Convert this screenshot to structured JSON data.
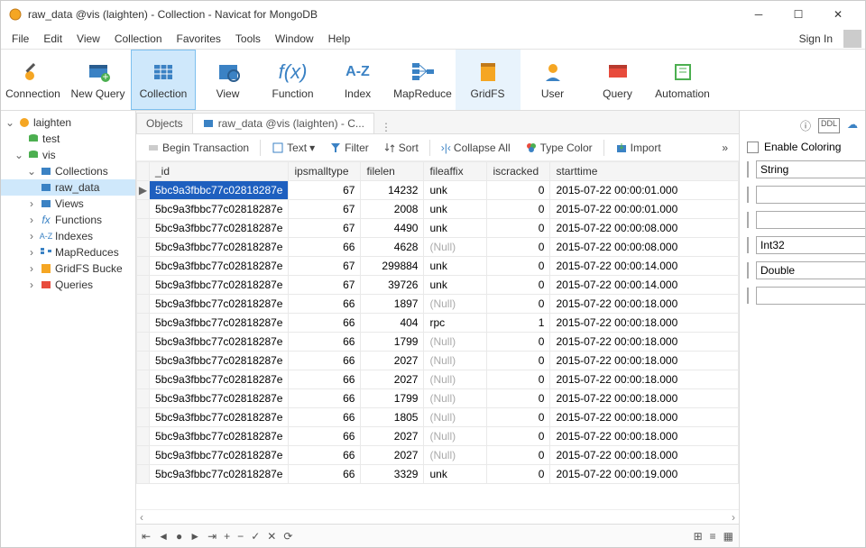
{
  "window": {
    "title": "raw_data @vis (laighten) - Collection - Navicat for MongoDB"
  },
  "menu": {
    "file": "File",
    "edit": "Edit",
    "view": "View",
    "collection": "Collection",
    "favorites": "Favorites",
    "tools": "Tools",
    "window": "Window",
    "help": "Help",
    "signin": "Sign In"
  },
  "toolbar": {
    "connection": "Connection",
    "newquery": "New Query",
    "collection": "Collection",
    "view": "View",
    "function": "Function",
    "index": "Index",
    "mapreduce": "MapReduce",
    "gridfs": "GridFS",
    "user": "User",
    "query": "Query",
    "automation": "Automation"
  },
  "tree": {
    "root": "laighten",
    "test": "test",
    "vis": "vis",
    "collections": "Collections",
    "raw_data": "raw_data",
    "views": "Views",
    "functions": "Functions",
    "indexes": "Indexes",
    "mapreduces": "MapReduces",
    "gridfs": "GridFS Bucke",
    "queries": "Queries"
  },
  "tabs": {
    "objects": "Objects",
    "active": "raw_data @vis (laighten) - C..."
  },
  "toolbar2": {
    "begin": "Begin Transaction",
    "text": "Text",
    "filter": "Filter",
    "sort": "Sort",
    "collapse": "Collapse All",
    "typecolor": "Type Color",
    "import": "Import"
  },
  "columns": {
    "id": "_id",
    "ipsmalltype": "ipsmalltype",
    "filelen": "filelen",
    "fileaffix": "fileaffix",
    "iscracked": "iscracked",
    "starttime": "starttime"
  },
  "rows": [
    {
      "id": "5bc9a3fbbc77c02818287e",
      "ip": 67,
      "len": 14232,
      "aff": "unk",
      "cr": 0,
      "st": "2015-07-22 00:00:01.000",
      "sel": true
    },
    {
      "id": "5bc9a3fbbc77c02818287e",
      "ip": 67,
      "len": 2008,
      "aff": "unk",
      "cr": 0,
      "st": "2015-07-22 00:00:01.000"
    },
    {
      "id": "5bc9a3fbbc77c02818287e",
      "ip": 67,
      "len": 4490,
      "aff": "unk",
      "cr": 0,
      "st": "2015-07-22 00:00:08.000"
    },
    {
      "id": "5bc9a3fbbc77c02818287e",
      "ip": 66,
      "len": 4628,
      "aff": "(Null)",
      "cr": 0,
      "st": "2015-07-22 00:00:08.000",
      "null": true
    },
    {
      "id": "5bc9a3fbbc77c02818287e",
      "ip": 67,
      "len": 299884,
      "aff": "unk",
      "cr": 0,
      "st": "2015-07-22 00:00:14.000"
    },
    {
      "id": "5bc9a3fbbc77c02818287e",
      "ip": 67,
      "len": 39726,
      "aff": "unk",
      "cr": 0,
      "st": "2015-07-22 00:00:14.000"
    },
    {
      "id": "5bc9a3fbbc77c02818287e",
      "ip": 66,
      "len": 1897,
      "aff": "(Null)",
      "cr": 0,
      "st": "2015-07-22 00:00:18.000",
      "null": true
    },
    {
      "id": "5bc9a3fbbc77c02818287e",
      "ip": 66,
      "len": 404,
      "aff": "rpc",
      "cr": 1,
      "st": "2015-07-22 00:00:18.000"
    },
    {
      "id": "5bc9a3fbbc77c02818287e",
      "ip": 66,
      "len": 1799,
      "aff": "(Null)",
      "cr": 0,
      "st": "2015-07-22 00:00:18.000",
      "null": true
    },
    {
      "id": "5bc9a3fbbc77c02818287e",
      "ip": 66,
      "len": 2027,
      "aff": "(Null)",
      "cr": 0,
      "st": "2015-07-22 00:00:18.000",
      "null": true
    },
    {
      "id": "5bc9a3fbbc77c02818287e",
      "ip": 66,
      "len": 2027,
      "aff": "(Null)",
      "cr": 0,
      "st": "2015-07-22 00:00:18.000",
      "null": true
    },
    {
      "id": "5bc9a3fbbc77c02818287e",
      "ip": 66,
      "len": 1799,
      "aff": "(Null)",
      "cr": 0,
      "st": "2015-07-22 00:00:18.000",
      "null": true
    },
    {
      "id": "5bc9a3fbbc77c02818287e",
      "ip": 66,
      "len": 1805,
      "aff": "(Null)",
      "cr": 0,
      "st": "2015-07-22 00:00:18.000",
      "null": true
    },
    {
      "id": "5bc9a3fbbc77c02818287e",
      "ip": 66,
      "len": 2027,
      "aff": "(Null)",
      "cr": 0,
      "st": "2015-07-22 00:00:18.000",
      "null": true
    },
    {
      "id": "5bc9a3fbbc77c02818287e",
      "ip": 66,
      "len": 2027,
      "aff": "(Null)",
      "cr": 0,
      "st": "2015-07-22 00:00:18.000",
      "null": true
    },
    {
      "id": "5bc9a3fbbc77c02818287e",
      "ip": 66,
      "len": 3329,
      "aff": "unk",
      "cr": 0,
      "st": "2015-07-22 00:00:19.000"
    }
  ],
  "rightpanel": {
    "enable": "Enable Coloring",
    "string": "String",
    "int32": "Int32",
    "double": "Double"
  },
  "legend_colors": [
    "#e84b3c",
    "#e67e22",
    "#f1c40f",
    "#27ae60",
    "#2980d9",
    "#9b59b6"
  ]
}
